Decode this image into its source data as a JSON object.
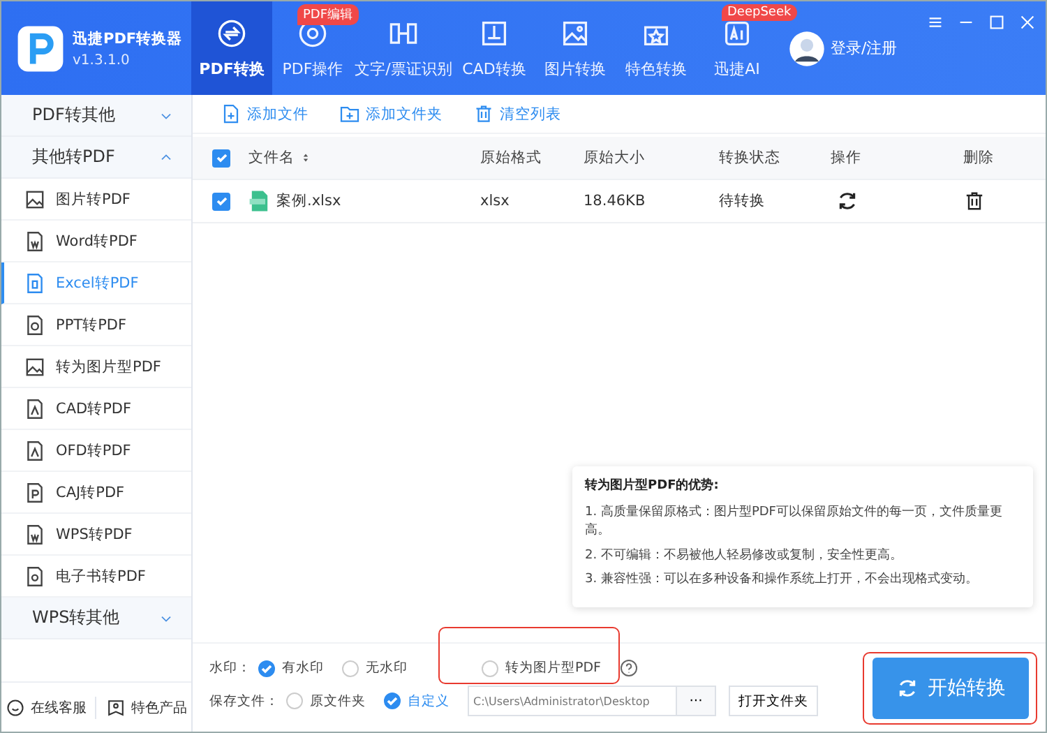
{
  "app": {
    "title": "迅捷PDF转换器",
    "version": "v1.3.1.0"
  },
  "nav": [
    {
      "label": "PDF转换",
      "selected": true
    },
    {
      "label": "PDF操作",
      "selected": false,
      "badge": "PDF编辑"
    },
    {
      "label": "文字/票证识别",
      "selected": false
    },
    {
      "label": "CAD转换",
      "selected": false
    },
    {
      "label": "图片转换",
      "selected": false
    },
    {
      "label": "特色转换",
      "selected": false
    },
    {
      "label": "迅捷AI",
      "selected": false,
      "badge": "DeepSeek"
    }
  ],
  "account": {
    "label": "登录/注册"
  },
  "sidebar": {
    "groups": [
      {
        "label": "PDF转其他",
        "expanded": false
      },
      {
        "label": "其他转PDF",
        "expanded": true,
        "children": [
          {
            "label": "图片转PDF",
            "selected": false
          },
          {
            "label": "Word转PDF",
            "selected": false
          },
          {
            "label": "Excel转PDF",
            "selected": true
          },
          {
            "label": "PPT转PDF",
            "selected": false
          },
          {
            "label": "转为图片型PDF",
            "selected": false
          },
          {
            "label": "CAD转PDF",
            "selected": false
          },
          {
            "label": "OFD转PDF",
            "selected": false
          },
          {
            "label": "CAJ转PDF",
            "selected": false
          },
          {
            "label": "WPS转PDF",
            "selected": false
          },
          {
            "label": "电子书转PDF",
            "selected": false
          }
        ]
      },
      {
        "label": "WPS转其他",
        "expanded": false
      }
    ],
    "footer": [
      "在线客服",
      "特色产品"
    ]
  },
  "toolbar": [
    "添加文件",
    "添加文件夹",
    "清空列表"
  ],
  "table": {
    "all_checked": true,
    "columns": [
      "文件名",
      "原始格式",
      "原始大小",
      "转换状态",
      "操作",
      "删除"
    ],
    "rows": [
      {
        "checked": true,
        "name": "案例.xlsx",
        "format": "xlsx",
        "size": "18.46KB",
        "status": "待转换"
      }
    ]
  },
  "tooltip": {
    "title": "转为图片型PDF的优势:",
    "items": [
      "1. 高质量保留原格式：图片型PDF可以保留原始文件的每一页，文件质量更高。",
      "2. 不可编辑：不易被他人轻易修改或复制，安全性更高。",
      "3. 兼容性强：可以在多种设备和操作系统上打开，不会出现格式变动。"
    ]
  },
  "options": {
    "watermark_label": "水印：",
    "watermark": [
      {
        "label": "有水印",
        "selected": true
      },
      {
        "label": "无水印",
        "selected": false
      }
    ],
    "image_pdf": {
      "label": "转为图片型PDF",
      "checked": false
    },
    "save_label": "保存文件：",
    "save": [
      {
        "label": "原文件夹",
        "selected": false
      },
      {
        "label": "自定义",
        "selected": true
      }
    ],
    "path": "C:\\Users\\Administrator\\Desktop",
    "browse": "···",
    "open_folder": "打开文件夹"
  },
  "start": {
    "label": "开始转换"
  }
}
